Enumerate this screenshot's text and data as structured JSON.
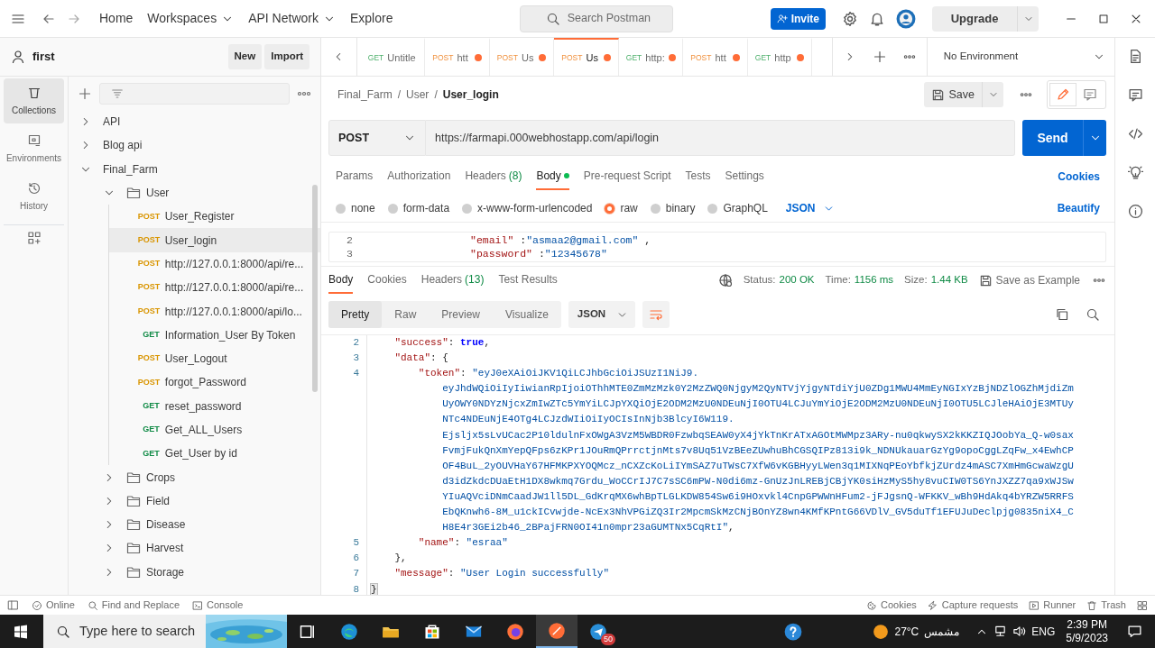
{
  "header": {
    "nav": [
      {
        "label": "Home",
        "menu": false
      },
      {
        "label": "Workspaces",
        "menu": true
      },
      {
        "label": "API Network",
        "menu": true
      },
      {
        "label": "Explore",
        "menu": false
      }
    ],
    "search": {
      "placeholder": "Search Postman"
    },
    "invite": "Invite",
    "upgrade": "Upgrade"
  },
  "workspace": {
    "name": "first",
    "buttons": [
      "New",
      "Import"
    ]
  },
  "rail": [
    {
      "label": "Collections",
      "selected": true
    },
    {
      "label": "Environments",
      "selected": false
    },
    {
      "label": "History",
      "selected": false
    }
  ],
  "tree": [
    {
      "kind": "collection",
      "label": "API",
      "expanded": false
    },
    {
      "kind": "collection",
      "label": "Blog api",
      "expanded": false
    },
    {
      "kind": "collection",
      "label": "Final_Farm",
      "expanded": true,
      "children": [
        {
          "kind": "folder",
          "label": "User",
          "expanded": true,
          "children": [
            {
              "kind": "request",
              "method": "POST",
              "label": "User_Register",
              "selected": false
            },
            {
              "kind": "request",
              "method": "POST",
              "label": "User_login",
              "selected": true
            },
            {
              "kind": "request",
              "method": "POST",
              "label": "http://127.0.0.1:8000/api/re...",
              "selected": false
            },
            {
              "kind": "request",
              "method": "POST",
              "label": "http://127.0.0.1:8000/api/re...",
              "selected": false
            },
            {
              "kind": "request",
              "method": "POST",
              "label": "http://127.0.0.1:8000/api/lo...",
              "selected": false
            },
            {
              "kind": "request",
              "method": "GET",
              "label": "Information_User By Token",
              "selected": false
            },
            {
              "kind": "request",
              "method": "POST",
              "label": "User_Logout",
              "selected": false
            },
            {
              "kind": "request",
              "method": "POST",
              "label": "forgot_Password",
              "selected": false
            },
            {
              "kind": "request",
              "method": "GET",
              "label": "reset_password",
              "selected": false
            },
            {
              "kind": "request",
              "method": "GET",
              "label": "Get_ALL_Users",
              "selected": false
            },
            {
              "kind": "request",
              "method": "GET",
              "label": "Get_User by id",
              "selected": false
            }
          ]
        },
        {
          "kind": "folder",
          "label": "Crops",
          "expanded": false
        },
        {
          "kind": "folder",
          "label": "Field",
          "expanded": false
        },
        {
          "kind": "folder",
          "label": "Disease",
          "expanded": false
        },
        {
          "kind": "folder",
          "label": "Harvest",
          "expanded": false
        },
        {
          "kind": "folder",
          "label": "Storage",
          "expanded": false
        }
      ]
    }
  ],
  "tabs": [
    {
      "method": "GET",
      "label": "Untitle",
      "unsaved": false,
      "selected": false
    },
    {
      "method": "POST",
      "label": "htt",
      "unsaved": true,
      "selected": false
    },
    {
      "method": "POST",
      "label": "Us",
      "unsaved": true,
      "selected": false
    },
    {
      "method": "POST",
      "label": "Us",
      "unsaved": true,
      "selected": true
    },
    {
      "method": "GET",
      "label": "http:",
      "unsaved": true,
      "selected": false
    },
    {
      "method": "POST",
      "label": "htt",
      "unsaved": true,
      "selected": false
    },
    {
      "method": "GET",
      "label": "http",
      "unsaved": true,
      "selected": false
    }
  ],
  "environment": "No Environment",
  "breadcrumb": {
    "separator": "/",
    "items": [
      "Final_Farm",
      "User",
      "User_login"
    ]
  },
  "save": "Save",
  "request": {
    "method": "POST",
    "url": "https://farmapi.000webhostapp.com/api/login",
    "send": "Send"
  },
  "request_tabs": [
    {
      "label": "Params",
      "dot": false,
      "selected": false
    },
    {
      "label": "Authorization",
      "dot": false,
      "selected": false
    },
    {
      "label": "Headers",
      "count": "(8)",
      "dot": false,
      "selected": false
    },
    {
      "label": "Body",
      "dot": true,
      "selected": true
    },
    {
      "label": "Pre-request Script",
      "dot": false,
      "selected": false
    },
    {
      "label": "Tests",
      "dot": false,
      "selected": false
    },
    {
      "label": "Settings",
      "dot": false,
      "selected": false
    }
  ],
  "cookies_link": "Cookies",
  "body_types": [
    {
      "label": "none",
      "selected": false
    },
    {
      "label": "form-data",
      "selected": false
    },
    {
      "label": "x-www-form-urlencoded",
      "selected": false
    },
    {
      "label": "raw",
      "selected": true
    },
    {
      "label": "binary",
      "selected": false
    },
    {
      "label": "GraphQL",
      "selected": false
    }
  ],
  "body_format": "JSON",
  "beautify": "Beautify",
  "request_code": [
    {
      "line": "2",
      "parts": [
        {
          "kind": "key",
          "text": "\"email\""
        },
        {
          "kind": "punct",
          "text": " :"
        },
        {
          "kind": "string",
          "text": "\"asmaa2@gmail.com\""
        },
        {
          "kind": "punct",
          "text": " ,"
        }
      ]
    },
    {
      "line": "3",
      "parts": [
        {
          "kind": "key",
          "text": "\"password\""
        },
        {
          "kind": "punct",
          "text": " :"
        },
        {
          "kind": "string",
          "text": "\"12345678\""
        }
      ]
    }
  ],
  "response": {
    "tabs": [
      {
        "label": "Body",
        "selected": true
      },
      {
        "label": "Cookies",
        "selected": false
      },
      {
        "label": "Headers",
        "count": "(13)",
        "selected": false
      },
      {
        "label": "Test Results",
        "selected": false
      }
    ],
    "status_label": "Status:",
    "status": "200 OK",
    "time_label": "Time:",
    "time": "1156 ms",
    "size_label": "Size:",
    "size": "1.44 KB",
    "save_example": "Save as Example",
    "views": [
      {
        "label": "Pretty",
        "selected": true
      },
      {
        "label": "Raw",
        "selected": false
      },
      {
        "label": "Preview",
        "selected": false
      },
      {
        "label": "Visualize",
        "selected": false
      }
    ],
    "format": "JSON"
  },
  "response_code": [
    {
      "kind": "line",
      "line": "2",
      "parts": [
        {
          "kind": "key",
          "text": "    \"success\""
        },
        {
          "kind": "punct",
          "text": ": "
        },
        {
          "kind": "bool",
          "text": "true"
        },
        {
          "kind": "punct",
          "text": ","
        }
      ]
    },
    {
      "kind": "line",
      "line": "3",
      "parts": [
        {
          "kind": "key",
          "text": "    \"data\""
        },
        {
          "kind": "punct",
          "text": ": {"
        }
      ]
    },
    {
      "kind": "line",
      "line": "4",
      "parts": [
        {
          "kind": "key",
          "text": "        \"token\""
        },
        {
          "kind": "punct",
          "text": ": "
        },
        {
          "kind": "string",
          "text": "\"eyJ0eXAiOiJKV1QiLCJhbGciOiJSUzI1NiJ9."
        }
      ]
    },
    {
      "kind": "wrap",
      "parts": [
        {
          "kind": "string",
          "text": "eyJhdWQiOiIyIiwianRpIjoiOThhMTE0ZmMzMzk0Y2MzZWQ0NjgyM2QyNTVjYjgyNTdiYjU0ZDg1MWU4MmEyNGIxYzBjNDZlOGZhMjdiZm"
        }
      ]
    },
    {
      "kind": "wrap",
      "parts": [
        {
          "kind": "string",
          "text": "UyOWY0NDYzNjcxZmIwZTc5YmYiLCJpYXQiOjE2ODM2MzU0NDEuNjI0OTU4LCJuYmYiOjE2ODM2MzU0NDEuNjI0OTU5LCJleHAiOjE3MTUy"
        }
      ]
    },
    {
      "kind": "wrap",
      "parts": [
        {
          "kind": "string",
          "text": "NTc4NDEuNjE4OTg4LCJzdWIiOiIyOCIsInNjb3BlcyI6W119."
        }
      ]
    },
    {
      "kind": "wrap",
      "parts": [
        {
          "kind": "string",
          "text": "Ejsljx5sLvUCac2P10ldulnFxOWgA3VzM5WBDR0FzwbqSEAW0yX4jYkTnKrATxAGOtMWMpz3ARy-nu0qkwySX2kKKZIQJOobYa_Q-w0sax"
        }
      ]
    },
    {
      "kind": "wrap",
      "parts": [
        {
          "kind": "string",
          "text": "FvmjFukQnXmYepQFps6zKPr1JOuRmQPrrctjnMts7v8Uq51VzBEeZUwhuBhCGSQIPz813i9k_NDNUkauarGzYg9opoCggLZqFw_x4EwhCP"
        }
      ]
    },
    {
      "kind": "wrap",
      "parts": [
        {
          "kind": "string",
          "text": "OF4BuL_2yOUVHaY67HFMKPXYOQMcz_nCXZcKoLiIYmSAZ7uTWsC7XfW6vKGBHyyLWen3q1MIXNqPEoYbfkjZUrdz4mASC7XmHmGcwaWzgU"
        }
      ]
    },
    {
      "kind": "wrap",
      "parts": [
        {
          "kind": "string",
          "text": "d3idZkdcDUaEtH1DX8wkmq7Grdu_WoCCrIJ7C7sSC6mPW-N0di6mz-GnUzJnLREBjCBjYK0siHzMyS5hy8vuCIW0TS6YnJXZZ7qa9xWJSw"
        }
      ]
    },
    {
      "kind": "wrap",
      "parts": [
        {
          "kind": "string",
          "text": "YIuAQVciDNmCaadJW1ll5DL_GdKrqMX6whBpTLGLKDW854Sw6i9HOxvkl4CnpGPWWnHFum2-jFJgsnQ-WFKKV_wBh9HdAkq4bYRZW5RRFS"
        }
      ]
    },
    {
      "kind": "wrap",
      "parts": [
        {
          "kind": "string",
          "text": "EbQKnwh6-8M_u1ckICvwjde-NcEx3NhVPGiZQ3Ir2MpcmSkMzCNjBOnYZ8wn4KMfKPntG66VDlV_GV5duTf1EFUJuDeclpjg0835niX4_C"
        }
      ]
    },
    {
      "kind": "wrap",
      "parts": [
        {
          "kind": "string",
          "text": "H8E4r3GEi2b46_2BPajFRN0OI41n0mpr23aGUMTNx5CqRtI\""
        },
        {
          "kind": "punct",
          "text": ","
        }
      ]
    },
    {
      "kind": "line",
      "line": "5",
      "parts": [
        {
          "kind": "key",
          "text": "        \"name\""
        },
        {
          "kind": "punct",
          "text": ": "
        },
        {
          "kind": "string",
          "text": "\"esraa\""
        }
      ]
    },
    {
      "kind": "line",
      "line": "6",
      "parts": [
        {
          "kind": "punct",
          "text": "    },"
        }
      ]
    },
    {
      "kind": "line",
      "line": "7",
      "parts": [
        {
          "kind": "key",
          "text": "    \"message\""
        },
        {
          "kind": "punct",
          "text": ": "
        },
        {
          "kind": "string",
          "text": "\"User Login successfully\""
        }
      ]
    },
    {
      "kind": "line",
      "line": "8",
      "parts": [
        {
          "kind": "bracket",
          "text": "}"
        }
      ]
    }
  ],
  "footer": {
    "left": [
      {
        "kind": "online",
        "label": "Online"
      },
      {
        "kind": "find",
        "label": "Find and Replace"
      },
      {
        "kind": "console",
        "label": "Console"
      }
    ],
    "right": [
      {
        "kind": "cookies",
        "label": "Cookies"
      },
      {
        "kind": "capture",
        "label": "Capture requests"
      },
      {
        "kind": "runner",
        "label": "Runner"
      },
      {
        "kind": "trash",
        "label": "Trash"
      }
    ]
  },
  "taskbar": {
    "search_placeholder": "Type here to search",
    "badge": "50",
    "temperature": "27°C",
    "weather": "مشمس",
    "language": "ENG",
    "time": "2:39 PM",
    "date": "5/9/2023"
  }
}
